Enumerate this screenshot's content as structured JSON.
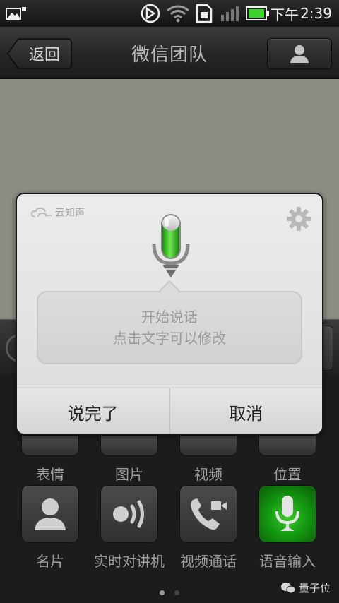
{
  "status_bar": {
    "time_prefix": "下午",
    "time": "2:39"
  },
  "header": {
    "back_label": "返回",
    "title": "微信团队"
  },
  "voice_dialog": {
    "brand": "云知声",
    "prompt_line1": "开始说话",
    "prompt_line2": "点击文字可以修改",
    "done_label": "说完了",
    "cancel_label": "取消",
    "mic_active_color": "#3ec61f"
  },
  "panel": {
    "row1": [
      {
        "label": "表情"
      },
      {
        "label": "图片"
      },
      {
        "label": "视频"
      },
      {
        "label": "位置"
      }
    ],
    "row2": [
      {
        "label": "名片",
        "icon": "person-icon"
      },
      {
        "label": "实时对讲机",
        "icon": "walkie-talkie-icon"
      },
      {
        "label": "视频通话",
        "icon": "video-call-icon"
      },
      {
        "label": "语音输入",
        "icon": "microphone-icon",
        "active": true
      }
    ]
  },
  "page_indicator": {
    "current": 1,
    "total": 2
  },
  "watermark": "量子位"
}
